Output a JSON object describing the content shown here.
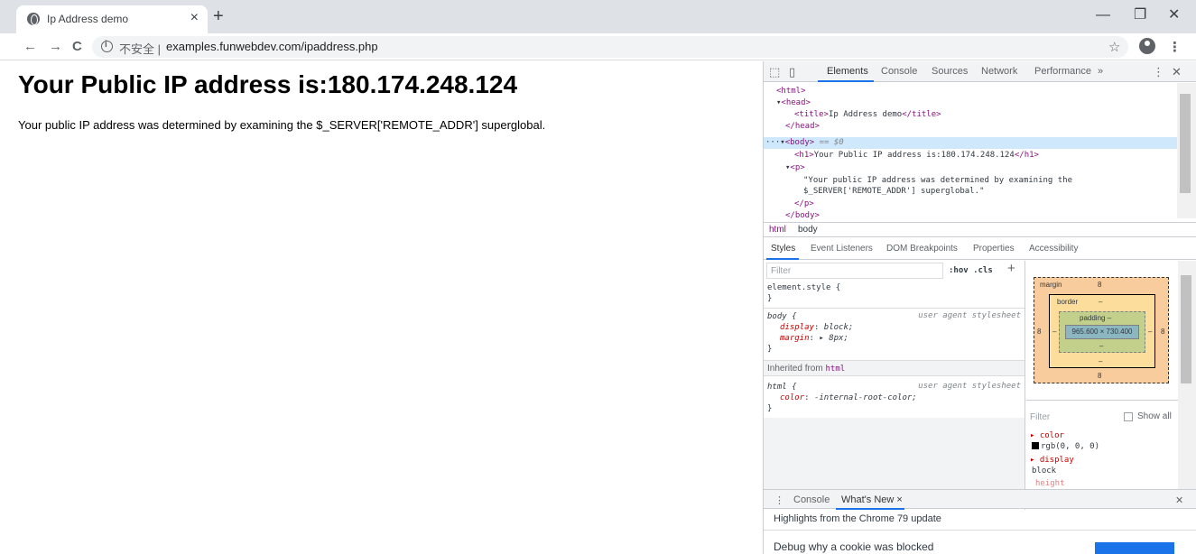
{
  "browser": {
    "tab_title": "Ip Address demo",
    "tab_close": "×",
    "new_tab": "+",
    "window_buttons": [
      "—",
      "❐",
      "✕"
    ],
    "insecure_label": "不安全",
    "url": "examples.funwebdev.com/ipaddress.php",
    "nav": {
      "back": "←",
      "forward": "→",
      "reload": "C"
    },
    "star": "☆",
    "menu": "⋮"
  },
  "page": {
    "heading": "Your Public IP address is:180.174.248.124",
    "paragraph": "Your public IP address was determined by examining the $_SERVER['REMOTE_ADDR'] superglobal."
  },
  "devtools": {
    "tabs": [
      "Elements",
      "Console",
      "Sources",
      "Network",
      "Performance",
      "»"
    ],
    "active_tab": "Elements",
    "dom": {
      "html_open": "<html>",
      "head_open": "<head>",
      "title_open": "<title>",
      "title_text": "Ip Address demo",
      "title_close": "</title>",
      "head_close": "</head>",
      "body_prefix": "···",
      "body_open": "<body>",
      "body_suffix": " == $0",
      "h1_open": "<h1>",
      "h1_text": "Your Public IP address is:180.174.248.124",
      "h1_close": "</h1>",
      "p_open": "<p>",
      "p_text_1": "\"Your public IP address was determined by examining the",
      "p_text_2": "$_SERVER['REMOTE_ADDR'] superglobal.\"",
      "p_close": "</p>",
      "body_close": "</body>"
    },
    "breadcrumbs": [
      "html",
      "body"
    ],
    "sub_tabs": [
      "Styles",
      "Event Listeners",
      "DOM Breakpoints",
      "Properties",
      "Accessibility"
    ],
    "styles": {
      "filter_placeholder": "Filter",
      "hov_cls": ":hov  .cls",
      "plus": "+",
      "element_style": "element.style {",
      "close_brace": "}",
      "body_selector": "body {",
      "user_agent": "user agent stylesheet",
      "display_prop": "display",
      "display_val": "block;",
      "margin_prop": "margin",
      "margin_val": "▸ 8px;",
      "inherited_label": "Inherited from",
      "inherited_tag": "html",
      "html_selector": "html {",
      "color_prop": "color",
      "color_val": "-internal-root-color;"
    },
    "box_model": {
      "margin_label": "margin",
      "margin_value": "8",
      "border_label": "border",
      "border_value": "–",
      "padding_label": "padding –",
      "content": "965.600 × 730.400",
      "left_outer": "8",
      "right_outer": "8",
      "bottom_margin": "8",
      "dash": "–"
    },
    "computed": {
      "filter_placeholder": "Filter",
      "show_all": "Show all",
      "color_prop": "▸ color",
      "color_val": "rgb(0, 0, 0)",
      "display_prop": "▸ display",
      "display_val": "block",
      "height_prop": "height"
    },
    "drawer": {
      "tabs": [
        "Console",
        "What's New ×"
      ],
      "active_tab": "What's New ×",
      "menu": "⋮",
      "close": "✕",
      "headline": "Highlights from the Chrome 79 update",
      "item": "Debug why a cookie was blocked"
    }
  }
}
